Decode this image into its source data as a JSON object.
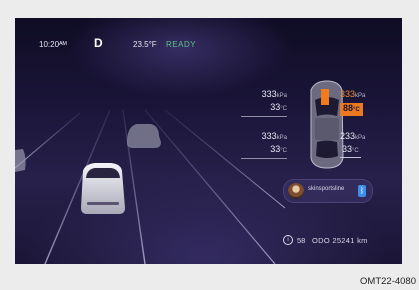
{
  "status_bar": {
    "time": "10:20ᴬᴹ",
    "gear": "D",
    "temperature": "23.5°F",
    "ready": "READY"
  },
  "tires": {
    "front_left": {
      "pressure": "333",
      "pressure_unit": "kPa",
      "temp": "33",
      "temp_unit": "°C"
    },
    "front_right": {
      "pressure": "333",
      "pressure_unit": "kPa",
      "temp": "88",
      "temp_unit": "°C"
    },
    "rear_left": {
      "pressure": "333",
      "pressure_unit": "kPa",
      "temp": "33",
      "temp_unit": "°C"
    },
    "rear_right": {
      "pressure": "233",
      "pressure_unit": "kPa",
      "temp": "33",
      "temp_unit": "°C"
    }
  },
  "phone": {
    "contact_name": "skinsportsline",
    "bluetooth_icon": "bluetooth-icon"
  },
  "bottom_bar": {
    "trip_icon": "info-circle-icon",
    "trip": "58",
    "odometer": "ODO  25241 km"
  },
  "caption": "OMT22-4080",
  "colors": {
    "ready": "#5ec28a",
    "warning": "#ea7a22",
    "bluetooth": "#3c8ee8"
  }
}
